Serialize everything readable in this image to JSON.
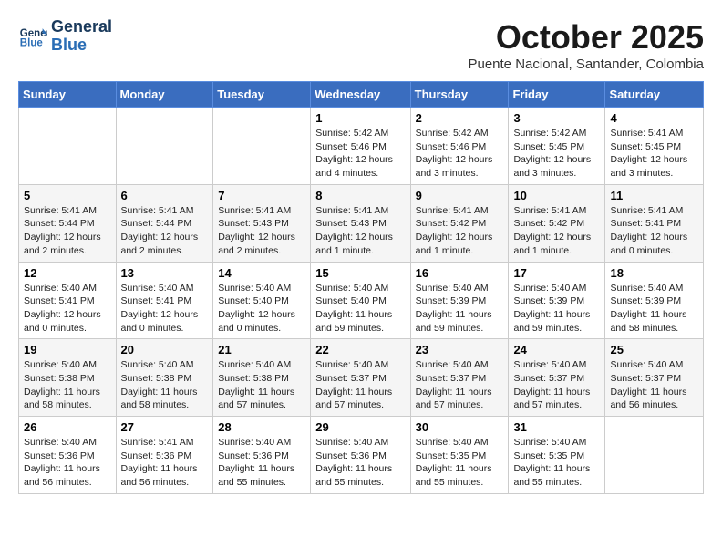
{
  "header": {
    "logo_line1": "General",
    "logo_line2": "Blue",
    "month": "October 2025",
    "location": "Puente Nacional, Santander, Colombia"
  },
  "days_of_week": [
    "Sunday",
    "Monday",
    "Tuesday",
    "Wednesday",
    "Thursday",
    "Friday",
    "Saturday"
  ],
  "weeks": [
    [
      {
        "day": "",
        "info": ""
      },
      {
        "day": "",
        "info": ""
      },
      {
        "day": "",
        "info": ""
      },
      {
        "day": "1",
        "info": "Sunrise: 5:42 AM\nSunset: 5:46 PM\nDaylight: 12 hours\nand 4 minutes."
      },
      {
        "day": "2",
        "info": "Sunrise: 5:42 AM\nSunset: 5:46 PM\nDaylight: 12 hours\nand 3 minutes."
      },
      {
        "day": "3",
        "info": "Sunrise: 5:42 AM\nSunset: 5:45 PM\nDaylight: 12 hours\nand 3 minutes."
      },
      {
        "day": "4",
        "info": "Sunrise: 5:41 AM\nSunset: 5:45 PM\nDaylight: 12 hours\nand 3 minutes."
      }
    ],
    [
      {
        "day": "5",
        "info": "Sunrise: 5:41 AM\nSunset: 5:44 PM\nDaylight: 12 hours\nand 2 minutes."
      },
      {
        "day": "6",
        "info": "Sunrise: 5:41 AM\nSunset: 5:44 PM\nDaylight: 12 hours\nand 2 minutes."
      },
      {
        "day": "7",
        "info": "Sunrise: 5:41 AM\nSunset: 5:43 PM\nDaylight: 12 hours\nand 2 minutes."
      },
      {
        "day": "8",
        "info": "Sunrise: 5:41 AM\nSunset: 5:43 PM\nDaylight: 12 hours\nand 1 minute."
      },
      {
        "day": "9",
        "info": "Sunrise: 5:41 AM\nSunset: 5:42 PM\nDaylight: 12 hours\nand 1 minute."
      },
      {
        "day": "10",
        "info": "Sunrise: 5:41 AM\nSunset: 5:42 PM\nDaylight: 12 hours\nand 1 minute."
      },
      {
        "day": "11",
        "info": "Sunrise: 5:41 AM\nSunset: 5:41 PM\nDaylight: 12 hours\nand 0 minutes."
      }
    ],
    [
      {
        "day": "12",
        "info": "Sunrise: 5:40 AM\nSunset: 5:41 PM\nDaylight: 12 hours\nand 0 minutes."
      },
      {
        "day": "13",
        "info": "Sunrise: 5:40 AM\nSunset: 5:41 PM\nDaylight: 12 hours\nand 0 minutes."
      },
      {
        "day": "14",
        "info": "Sunrise: 5:40 AM\nSunset: 5:40 PM\nDaylight: 12 hours\nand 0 minutes."
      },
      {
        "day": "15",
        "info": "Sunrise: 5:40 AM\nSunset: 5:40 PM\nDaylight: 11 hours\nand 59 minutes."
      },
      {
        "day": "16",
        "info": "Sunrise: 5:40 AM\nSunset: 5:39 PM\nDaylight: 11 hours\nand 59 minutes."
      },
      {
        "day": "17",
        "info": "Sunrise: 5:40 AM\nSunset: 5:39 PM\nDaylight: 11 hours\nand 59 minutes."
      },
      {
        "day": "18",
        "info": "Sunrise: 5:40 AM\nSunset: 5:39 PM\nDaylight: 11 hours\nand 58 minutes."
      }
    ],
    [
      {
        "day": "19",
        "info": "Sunrise: 5:40 AM\nSunset: 5:38 PM\nDaylight: 11 hours\nand 58 minutes."
      },
      {
        "day": "20",
        "info": "Sunrise: 5:40 AM\nSunset: 5:38 PM\nDaylight: 11 hours\nand 58 minutes."
      },
      {
        "day": "21",
        "info": "Sunrise: 5:40 AM\nSunset: 5:38 PM\nDaylight: 11 hours\nand 57 minutes."
      },
      {
        "day": "22",
        "info": "Sunrise: 5:40 AM\nSunset: 5:37 PM\nDaylight: 11 hours\nand 57 minutes."
      },
      {
        "day": "23",
        "info": "Sunrise: 5:40 AM\nSunset: 5:37 PM\nDaylight: 11 hours\nand 57 minutes."
      },
      {
        "day": "24",
        "info": "Sunrise: 5:40 AM\nSunset: 5:37 PM\nDaylight: 11 hours\nand 57 minutes."
      },
      {
        "day": "25",
        "info": "Sunrise: 5:40 AM\nSunset: 5:37 PM\nDaylight: 11 hours\nand 56 minutes."
      }
    ],
    [
      {
        "day": "26",
        "info": "Sunrise: 5:40 AM\nSunset: 5:36 PM\nDaylight: 11 hours\nand 56 minutes."
      },
      {
        "day": "27",
        "info": "Sunrise: 5:41 AM\nSunset: 5:36 PM\nDaylight: 11 hours\nand 56 minutes."
      },
      {
        "day": "28",
        "info": "Sunrise: 5:40 AM\nSunset: 5:36 PM\nDaylight: 11 hours\nand 55 minutes."
      },
      {
        "day": "29",
        "info": "Sunrise: 5:40 AM\nSunset: 5:36 PM\nDaylight: 11 hours\nand 55 minutes."
      },
      {
        "day": "30",
        "info": "Sunrise: 5:40 AM\nSunset: 5:35 PM\nDaylight: 11 hours\nand 55 minutes."
      },
      {
        "day": "31",
        "info": "Sunrise: 5:40 AM\nSunset: 5:35 PM\nDaylight: 11 hours\nand 55 minutes."
      },
      {
        "day": "",
        "info": ""
      }
    ]
  ]
}
